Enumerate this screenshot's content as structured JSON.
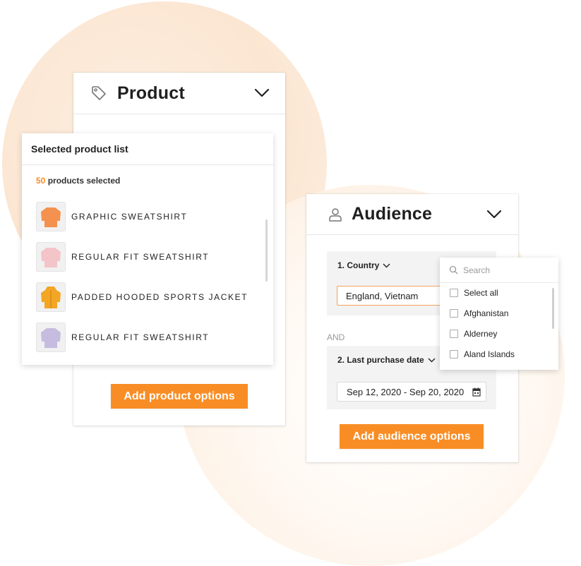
{
  "colors": {
    "accent": "#f98d25",
    "input_focus_border": "#f6a25a",
    "panel_grey": "#f3f3f3"
  },
  "product_card": {
    "title": "Product",
    "icon": "tag-icon",
    "button_label": "Add product options"
  },
  "product_list": {
    "title": "Selected product list",
    "count": "50",
    "count_suffix": " products selected",
    "items": [
      {
        "name": "GRAPHIC SWEATSHIRT",
        "color": "#f5914e"
      },
      {
        "name": "REGULAR FIT SWEATSHIRT",
        "color": "#f3c4c8"
      },
      {
        "name": "PADDED HOODED SPORTS JACKET",
        "color": "#f2a624"
      },
      {
        "name": "REGULAR FIT SWEATSHIRT",
        "color": "#c5bce0"
      }
    ]
  },
  "audience_card": {
    "title": "Audience",
    "icon": "person-icon",
    "country_label": "1. Country",
    "country_value": "England, Vietnam",
    "and_label": "AND",
    "purchase_label": "2. Last purchase date",
    "date_value": "Sep 12, 2020 - Sep 20, 2020",
    "button_label": "Add audience options"
  },
  "country_dropdown": {
    "search_placeholder": "Search",
    "options": [
      "Select all",
      "Afghanistan",
      "Alderney",
      "Aland Islands"
    ]
  }
}
